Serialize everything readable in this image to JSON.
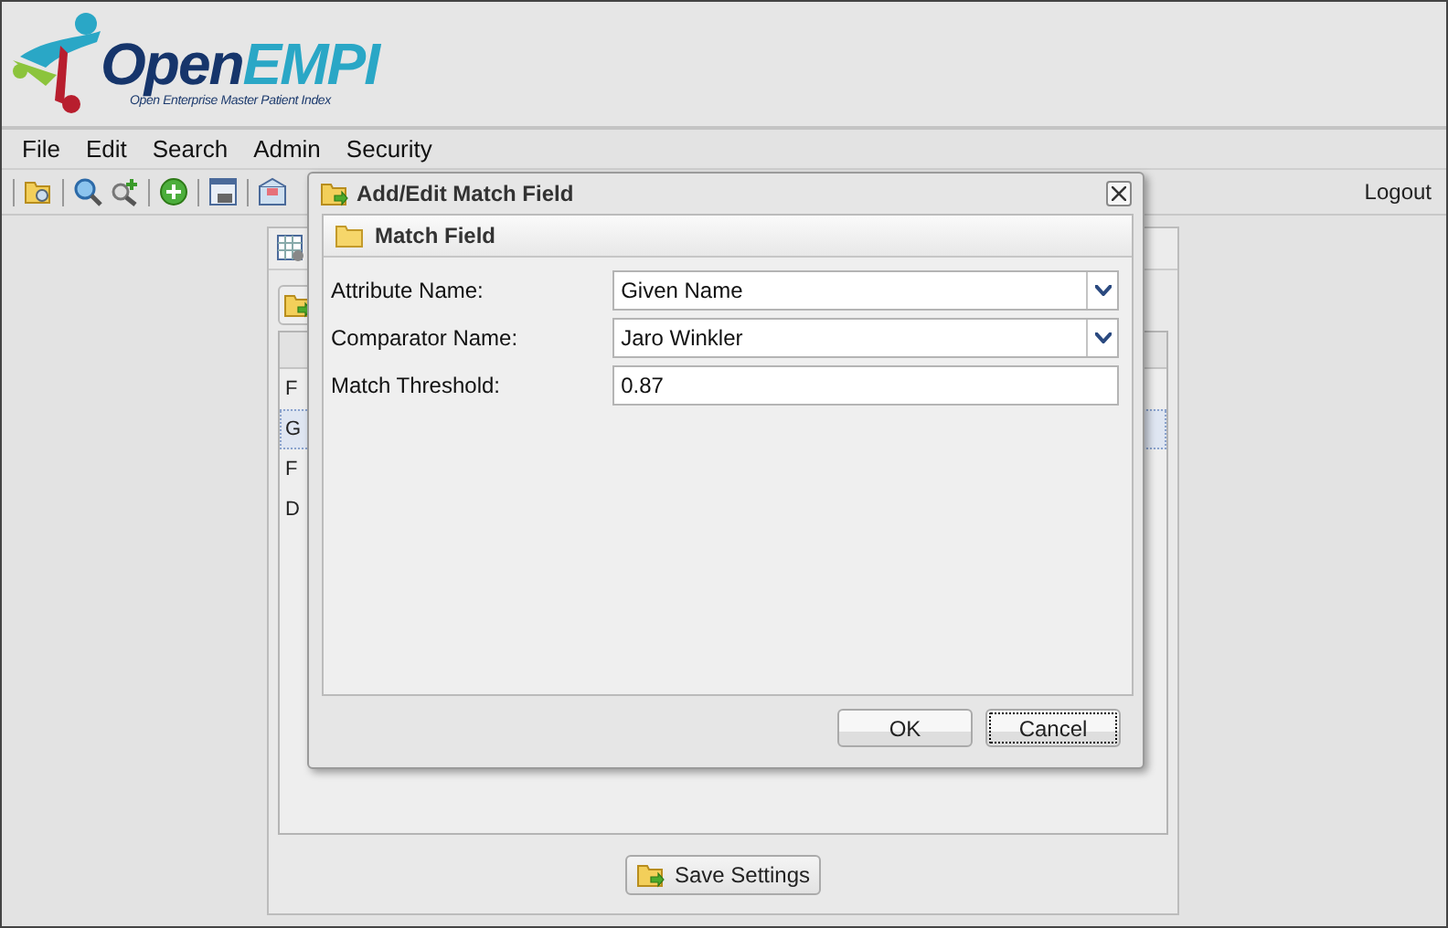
{
  "logo": {
    "title_parts": [
      "Open",
      "EMPI"
    ],
    "tagline": "Open Enterprise Master Patient Index"
  },
  "menu": [
    "File",
    "Edit",
    "Search",
    "Admin",
    "Security"
  ],
  "toolbar": {
    "logout": "Logout"
  },
  "background_panel": {
    "rows": [
      {
        "text": "F",
        "selected": false
      },
      {
        "text": "G",
        "selected": true
      },
      {
        "text": "F",
        "selected": false
      },
      {
        "text": "D",
        "selected": false
      }
    ],
    "save_button": "Save Settings"
  },
  "dialog": {
    "title": "Add/Edit Match Field",
    "section": "Match Field",
    "fields": [
      {
        "kind": "select",
        "label": "Attribute Name:",
        "value": "Given Name"
      },
      {
        "kind": "select",
        "label": "Comparator Name:",
        "value": "Jaro Winkler"
      },
      {
        "kind": "text",
        "label": "Match Threshold:",
        "value": "0.87"
      }
    ],
    "buttons": [
      {
        "label": "OK",
        "focused": false
      },
      {
        "label": "Cancel",
        "focused": true
      }
    ]
  }
}
